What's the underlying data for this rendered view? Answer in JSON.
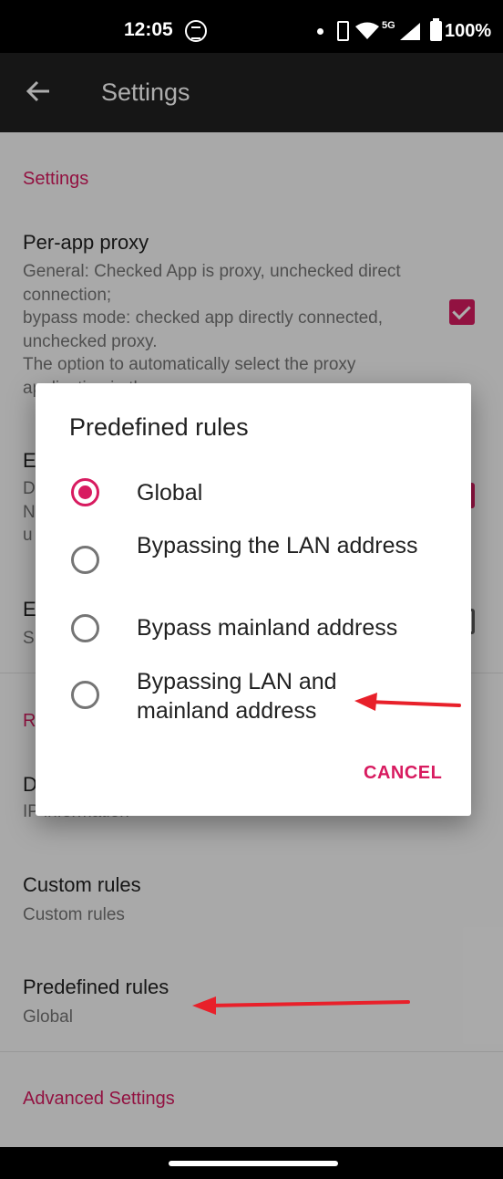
{
  "status_bar": {
    "time": "12:05",
    "network": "5G",
    "battery": "100%"
  },
  "app_bar": {
    "title": "Settings"
  },
  "sections": {
    "settings_header": "Settings",
    "per_app_proxy": {
      "title": "Per-app proxy",
      "summary": "General: Checked App is proxy, unchecked direct connection;\nbypass mode: checked app directly connected, unchecked proxy.\nThe option to automatically select the proxy application in the menu",
      "checked": true
    },
    "item2": {
      "title": "E",
      "summary": "D\nN\nu"
    },
    "item3": {
      "title": "E",
      "summary": "S"
    },
    "routing_header": "R",
    "item4": {
      "title": "D",
      "summary": "IP information"
    },
    "custom_rules": {
      "title": "Custom rules",
      "summary": "Custom rules"
    },
    "predefined_rules": {
      "title": "Predefined rules",
      "summary": "Global"
    },
    "advanced_header": "Advanced Settings"
  },
  "dialog": {
    "title": "Predefined rules",
    "options": [
      {
        "label": "Global",
        "selected": true
      },
      {
        "label": "Bypassing the LAN address",
        "selected": false
      },
      {
        "label": "Bypass mainland address",
        "selected": false
      },
      {
        "label": "Bypassing LAN and mainland address",
        "selected": false
      }
    ],
    "cancel_label": "CANCEL"
  },
  "colors": {
    "accent": "#d81b60",
    "appbar": "#212121",
    "annotation_arrow": "#e8202a"
  },
  "icons": [
    "back-arrow-icon",
    "app-badge-icon",
    "wifi-icon",
    "signal-icon",
    "battery-icon",
    "vpn-key-icon"
  ]
}
